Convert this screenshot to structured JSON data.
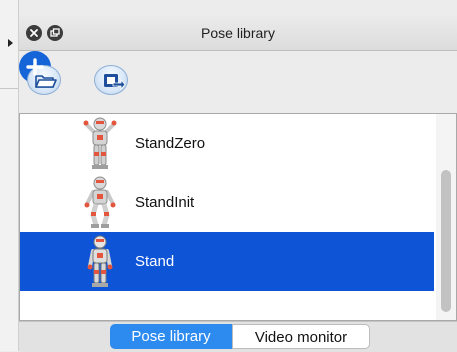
{
  "window": {
    "title": "Pose library"
  },
  "toolbar": {
    "buttons": [
      {
        "icon": "folder-open-icon"
      },
      {
        "icon": "import-icon"
      },
      {
        "icon": "plus-icon"
      }
    ]
  },
  "poses": [
    {
      "label": "StandZero",
      "selected": false
    },
    {
      "label": "StandInit",
      "selected": false
    },
    {
      "label": "Stand",
      "selected": true
    }
  ],
  "tabs": [
    {
      "label": "Pose library",
      "active": true
    },
    {
      "label": "Video monitor",
      "active": false
    }
  ],
  "colors": {
    "selection": "#0e54d6",
    "active_tab": "#2d8bf0",
    "add_button": "#1565d8"
  }
}
